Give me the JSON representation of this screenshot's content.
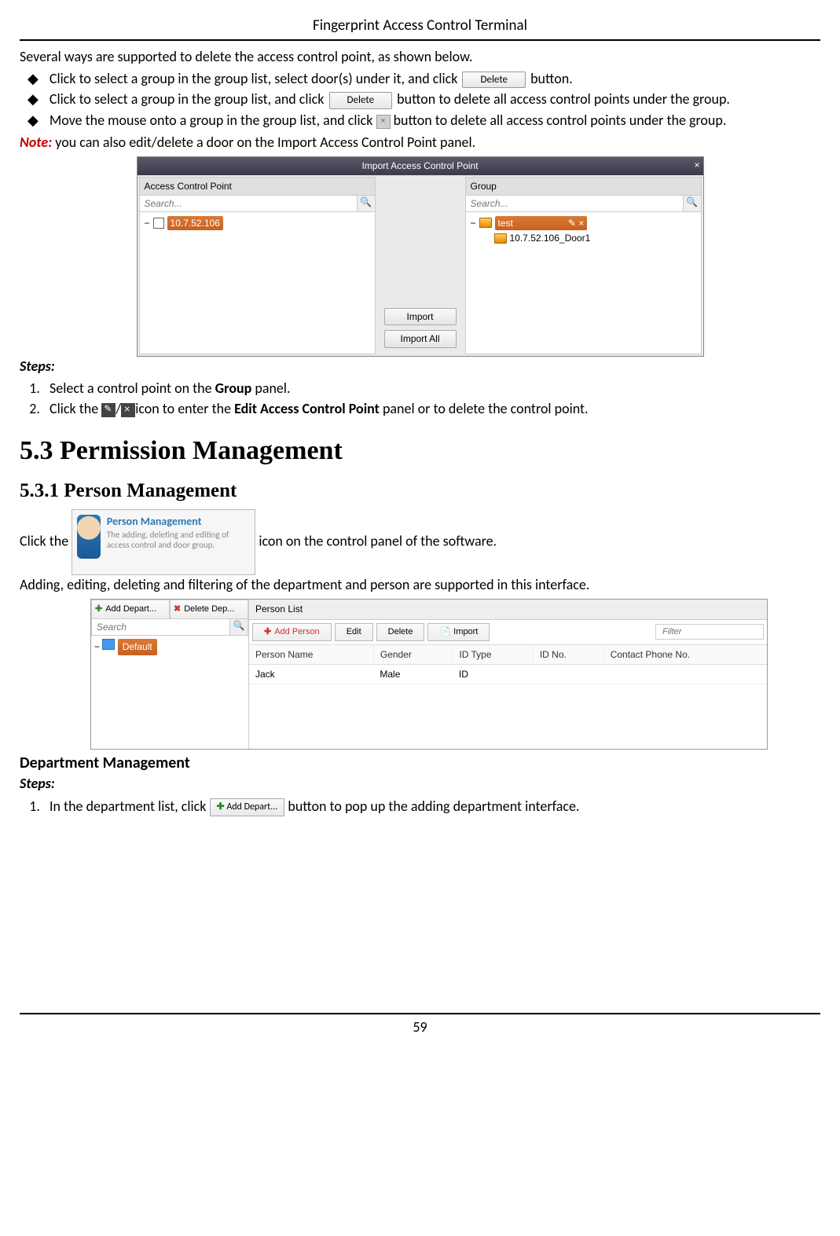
{
  "header": {
    "title": "Fingerprint Access Control Terminal"
  },
  "intro": "Several ways are supported to delete the access control point, as shown below.",
  "bullets": {
    "b1a": "Click to select a group in the group list, select door(s) under it, and click",
    "b1b": "button.",
    "b2a": "Click to select a group in the group list, and click",
    "b2b": "button to delete all access control points under the group.",
    "b3a": "Move the mouse onto a group in the group list, and click",
    "b3b": "button to delete all access control points under the group."
  },
  "delete_btn": "Delete",
  "note": {
    "label": "Note:",
    "text": " you can also edit/delete a door on the Import Access Control Point panel."
  },
  "shot1": {
    "title": "Import Access Control Point",
    "left_header": "Access Control Point",
    "right_header": "Group",
    "search_placeholder": "Search...",
    "ip": "10.7.52.106",
    "group_name": "test",
    "door": "10.7.52.106_Door1",
    "import_btn": "Import",
    "import_all_btn": "Import All"
  },
  "steps_label": "Steps:",
  "steps1": {
    "s1a": "Select a control point on the ",
    "s1b": "Group",
    "s1c": " panel.",
    "s2a": "Click the ",
    "s2b": "/",
    "s2c": "icon to enter the ",
    "s2d": "Edit Access Control Point",
    "s2e": " panel or to delete the control point."
  },
  "h1": "5.3 Permission Management",
  "h2": "5.3.1   Person Management",
  "pm_icon": {
    "title": "Person Management",
    "desc": "The adding, deleting and editing of access control and door group."
  },
  "pm_line1a": "Click the ",
  "pm_line1b": " icon on the control panel of the software.",
  "pm_line2": "Adding, editing, deleting and filtering of the department and person are supported in this interface.",
  "shot2": {
    "add_dept": "Add Depart...",
    "del_dept": "Delete Dep...",
    "search_placeholder": "Search",
    "default_node": "Default",
    "panel_title": "Person List",
    "add_person": "Add Person",
    "edit": "Edit",
    "delete": "Delete",
    "import": "Import",
    "filter_placeholder": "Filter",
    "cols": {
      "name": "Person Name",
      "gender": "Gender",
      "idtype": "ID Type",
      "idno": "ID No.",
      "phone": "Contact Phone No."
    },
    "row": {
      "name": "Jack",
      "gender": "Male",
      "idtype": "ID",
      "idno": "",
      "phone": ""
    }
  },
  "dept_hdr": "Department Management",
  "steps2": {
    "s1a": "In the department list, click",
    "s1b": "button to pop up the adding department interface."
  },
  "add_dept_btn": "Add Depart...",
  "page": "59"
}
